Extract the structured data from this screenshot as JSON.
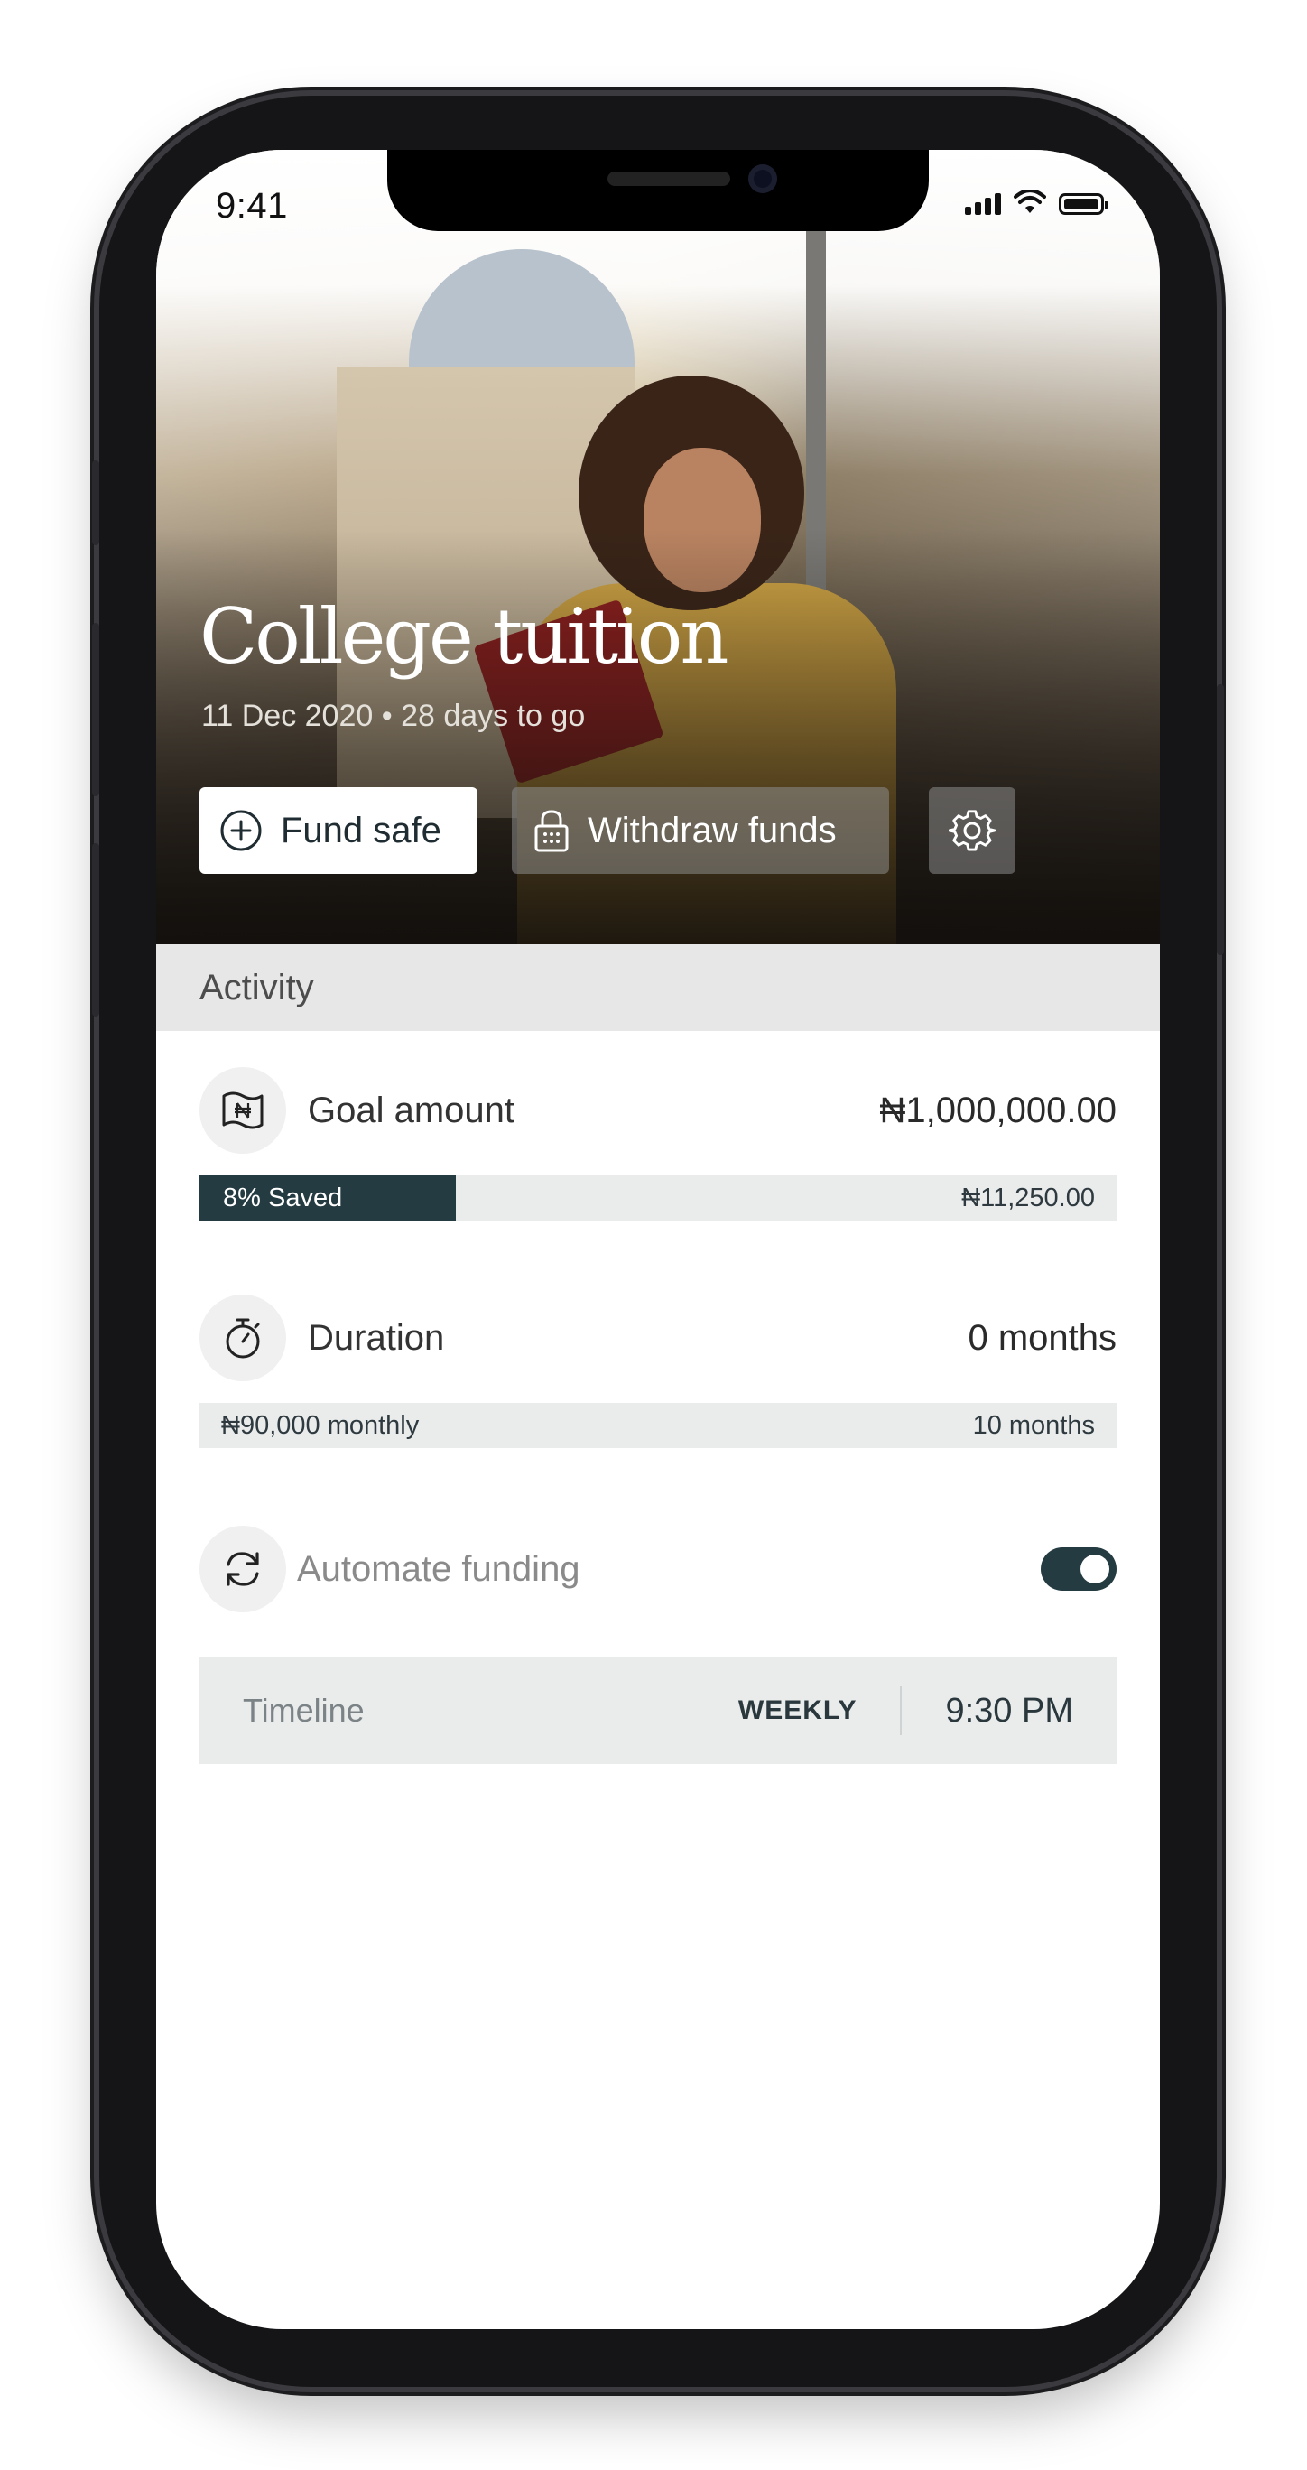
{
  "status_bar": {
    "time": "9:41"
  },
  "goal": {
    "title": "College tuition",
    "subtitle": "11 Dec 2020 • 28 days to go"
  },
  "actions": {
    "fund_label": "Fund safe",
    "withdraw_label": "Withdraw funds",
    "settings_icon": "gear-icon"
  },
  "activity": {
    "header": "Activity",
    "goal_amount": {
      "label": "Goal amount",
      "value": "₦1,000,000.00",
      "saved_label": "8% Saved",
      "saved_fraction": 0.28,
      "saved_amount": "₦11,250.00"
    },
    "duration": {
      "label": "Duration",
      "value": "0 months",
      "monthly": "₦90,000 monthly",
      "total": "10 months"
    },
    "automate": {
      "label": "Automate funding",
      "enabled": true
    },
    "timeline": {
      "label": "Timeline",
      "frequency": "WEEKLY",
      "time": "9:30 PM"
    }
  },
  "colors": {
    "accent": "#243b42",
    "panel": "#eaecec",
    "header_bg": "#e7e7e7"
  }
}
